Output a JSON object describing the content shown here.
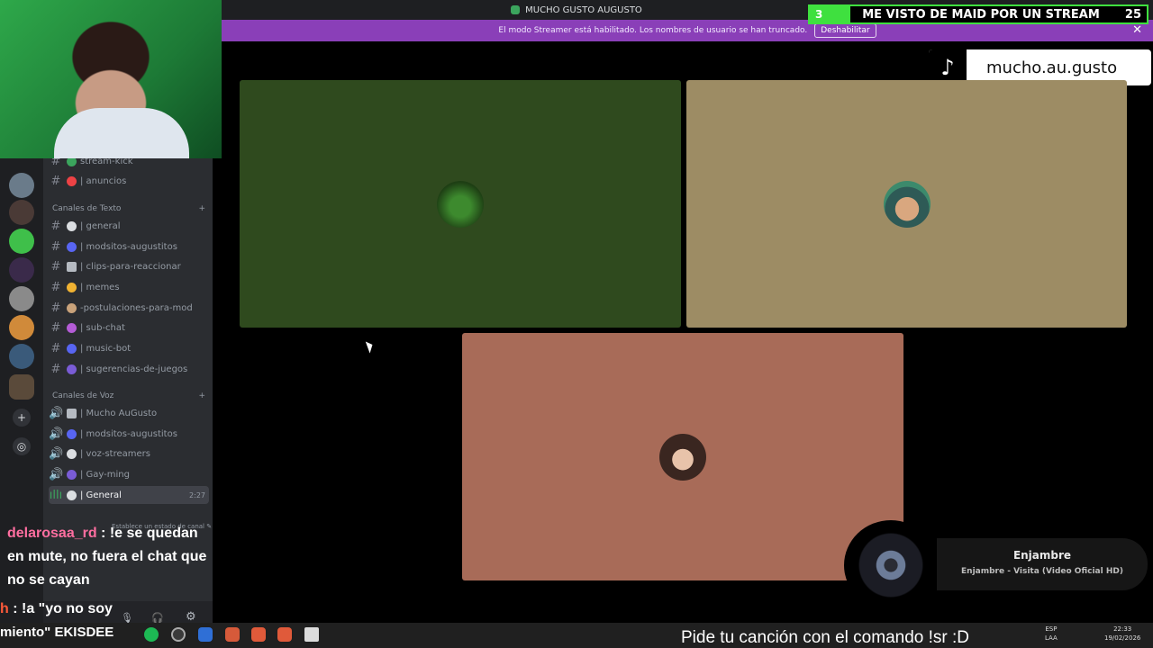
{
  "window": {
    "title": "MUCHO GUSTO AUGUSTO"
  },
  "banner": {
    "text": "El modo Streamer está habilitado. Los nombres de usuario se han truncado.",
    "button": "Deshabilitar"
  },
  "goal": {
    "current": "3",
    "title": "ME VISTO DE MAID POR UN STREAM",
    "target": "25",
    "progress_fraction": 0.12
  },
  "tiktok": {
    "handle": "mucho.au.gusto"
  },
  "sidebar": {
    "top_channels": [
      "stream-kick",
      "| anuncios"
    ],
    "text_category": "Canales de Texto",
    "text_channels": [
      "| general",
      "| modsitos-augustitos",
      "| clips-para-reaccionar",
      "| memes",
      "-postulaciones-para-mod",
      "| sub-chat",
      "| music-bot",
      "| sugerencias-de-juegos"
    ],
    "voice_category": "Canales de Voz",
    "voice_channels": [
      "| Mucho AuGusto",
      "| modsitos-augustitos",
      "| voz-streamers",
      "| Gay-ming"
    ],
    "active_voice": {
      "name": "| General",
      "time": "2:27",
      "status": "Establece un estado de canal"
    }
  },
  "chat": [
    {
      "user": "delarosaa_rd",
      "message": " : !e se quedan en mute, no fuera el chat que no se cayan"
    },
    {
      "user": "h",
      "message": " : !a \"yo no soy"
    }
  ],
  "chat_fragment": "miento\" EKISDEE",
  "now_playing": {
    "artist": "Enjambre",
    "track": "Enjambre - Visita (Video Oficial HD)"
  },
  "ticker": "Pide tu canción con el comando !sr :D",
  "tray": {
    "lang": "ESP",
    "layout": "LAA",
    "time": "22:33",
    "date": "19/02/2026"
  },
  "colors": {
    "banner": "#8a3fb8",
    "goal": "#3fe03f",
    "tile1": "#2f4a1e",
    "tile2": "#9d8c64",
    "tile3": "#a86b58"
  }
}
